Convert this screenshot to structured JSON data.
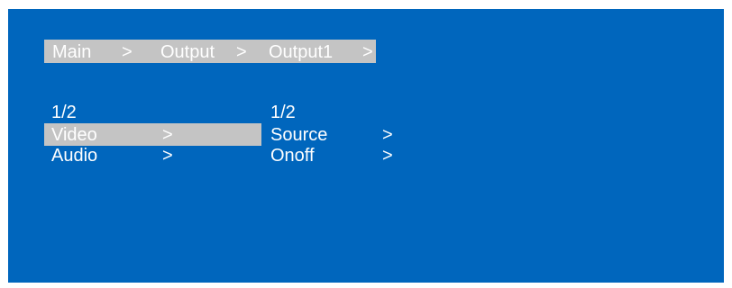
{
  "breadcrumb": {
    "items": [
      {
        "label": "Main",
        "sep": ">"
      },
      {
        "label": "Output",
        "sep": ">"
      },
      {
        "label": "Output1",
        "sep": ">"
      }
    ]
  },
  "left_menu": {
    "page": "1/2",
    "items": [
      {
        "label": "Video",
        "arrow": ">",
        "selected": true
      },
      {
        "label": "Audio",
        "arrow": ">",
        "selected": false
      }
    ]
  },
  "right_menu": {
    "page": "1/2",
    "items": [
      {
        "label": "Source",
        "arrow": ">"
      },
      {
        "label": "Onoff",
        "arrow": ">"
      }
    ]
  },
  "colors": {
    "background": "#0066bd",
    "highlight": "#c4c4c4",
    "text": "#ffffff"
  }
}
